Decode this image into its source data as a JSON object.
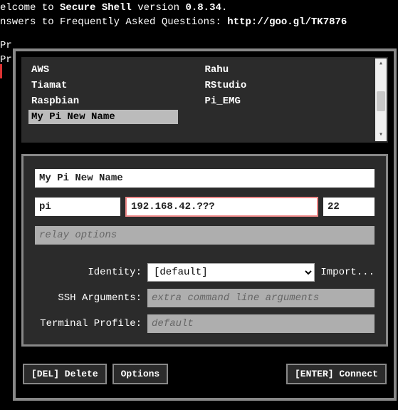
{
  "header": {
    "line1_pre": "elcome to ",
    "line1_app": "Secure Shell",
    "line1_mid": " version ",
    "line1_ver": "0.8.34",
    "line1_end": ".",
    "line2_pre": "nswers to Frequently Asked Questions: ",
    "line2_link": "http://goo.gl/TK7876",
    "line3": "Pr",
    "line4": "Pr"
  },
  "connections": {
    "items": [
      "AWS",
      "Rahu",
      "Tiamat",
      "RStudio",
      "Raspbian",
      "Pi_EMG"
    ],
    "selected": "My Pi New Name"
  },
  "form": {
    "name": "My Pi New Name",
    "user": "pi",
    "host": "192.168.42.???",
    "port": "22",
    "relay_placeholder": "relay options",
    "identity_label": "Identity:",
    "identity_selected": "[default]",
    "import_label": "Import...",
    "ssh_args_label": "SSH Arguments:",
    "ssh_args_placeholder": "extra command line arguments",
    "term_profile_label": "Terminal Profile:",
    "term_profile_value": "default"
  },
  "buttons": {
    "delete": "[DEL] Delete",
    "options": "Options",
    "connect": "[ENTER] Connect"
  }
}
